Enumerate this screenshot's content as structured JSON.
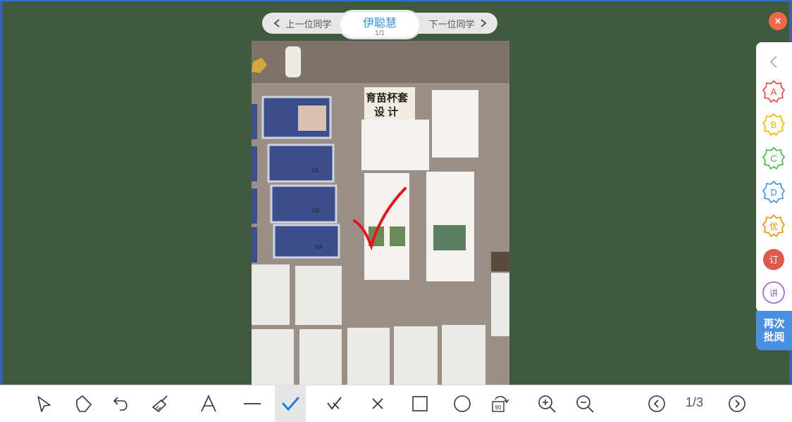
{
  "nav": {
    "prev_label": "上一位同学",
    "next_label": "下一位同学",
    "student_name": "伊聪慧",
    "page_count": "1/1"
  },
  "photo": {
    "poster_title_line1": "育苗杯套",
    "poster_title_line2": "设 计",
    "card_labels": [
      "01-",
      "03-",
      "04-"
    ]
  },
  "grades": [
    {
      "label": "A",
      "color": "#e8413c"
    },
    {
      "label": "B",
      "color": "#f0b400"
    },
    {
      "label": "C",
      "color": "#3db83d"
    },
    {
      "label": "D",
      "color": "#3a8ee6"
    },
    {
      "label": "优",
      "color": "#f08c00"
    },
    {
      "label": "订",
      "color": "#e05a4b"
    },
    {
      "label": "讲",
      "color": "#9b59d0"
    }
  ],
  "regrade_label": "再次\n批阅",
  "pager": {
    "text": "1/3"
  },
  "rotate_label": "90",
  "colors": {
    "board": "#3f5a3f",
    "accent": "#2f8fd8",
    "check": "#1e7fd8"
  }
}
